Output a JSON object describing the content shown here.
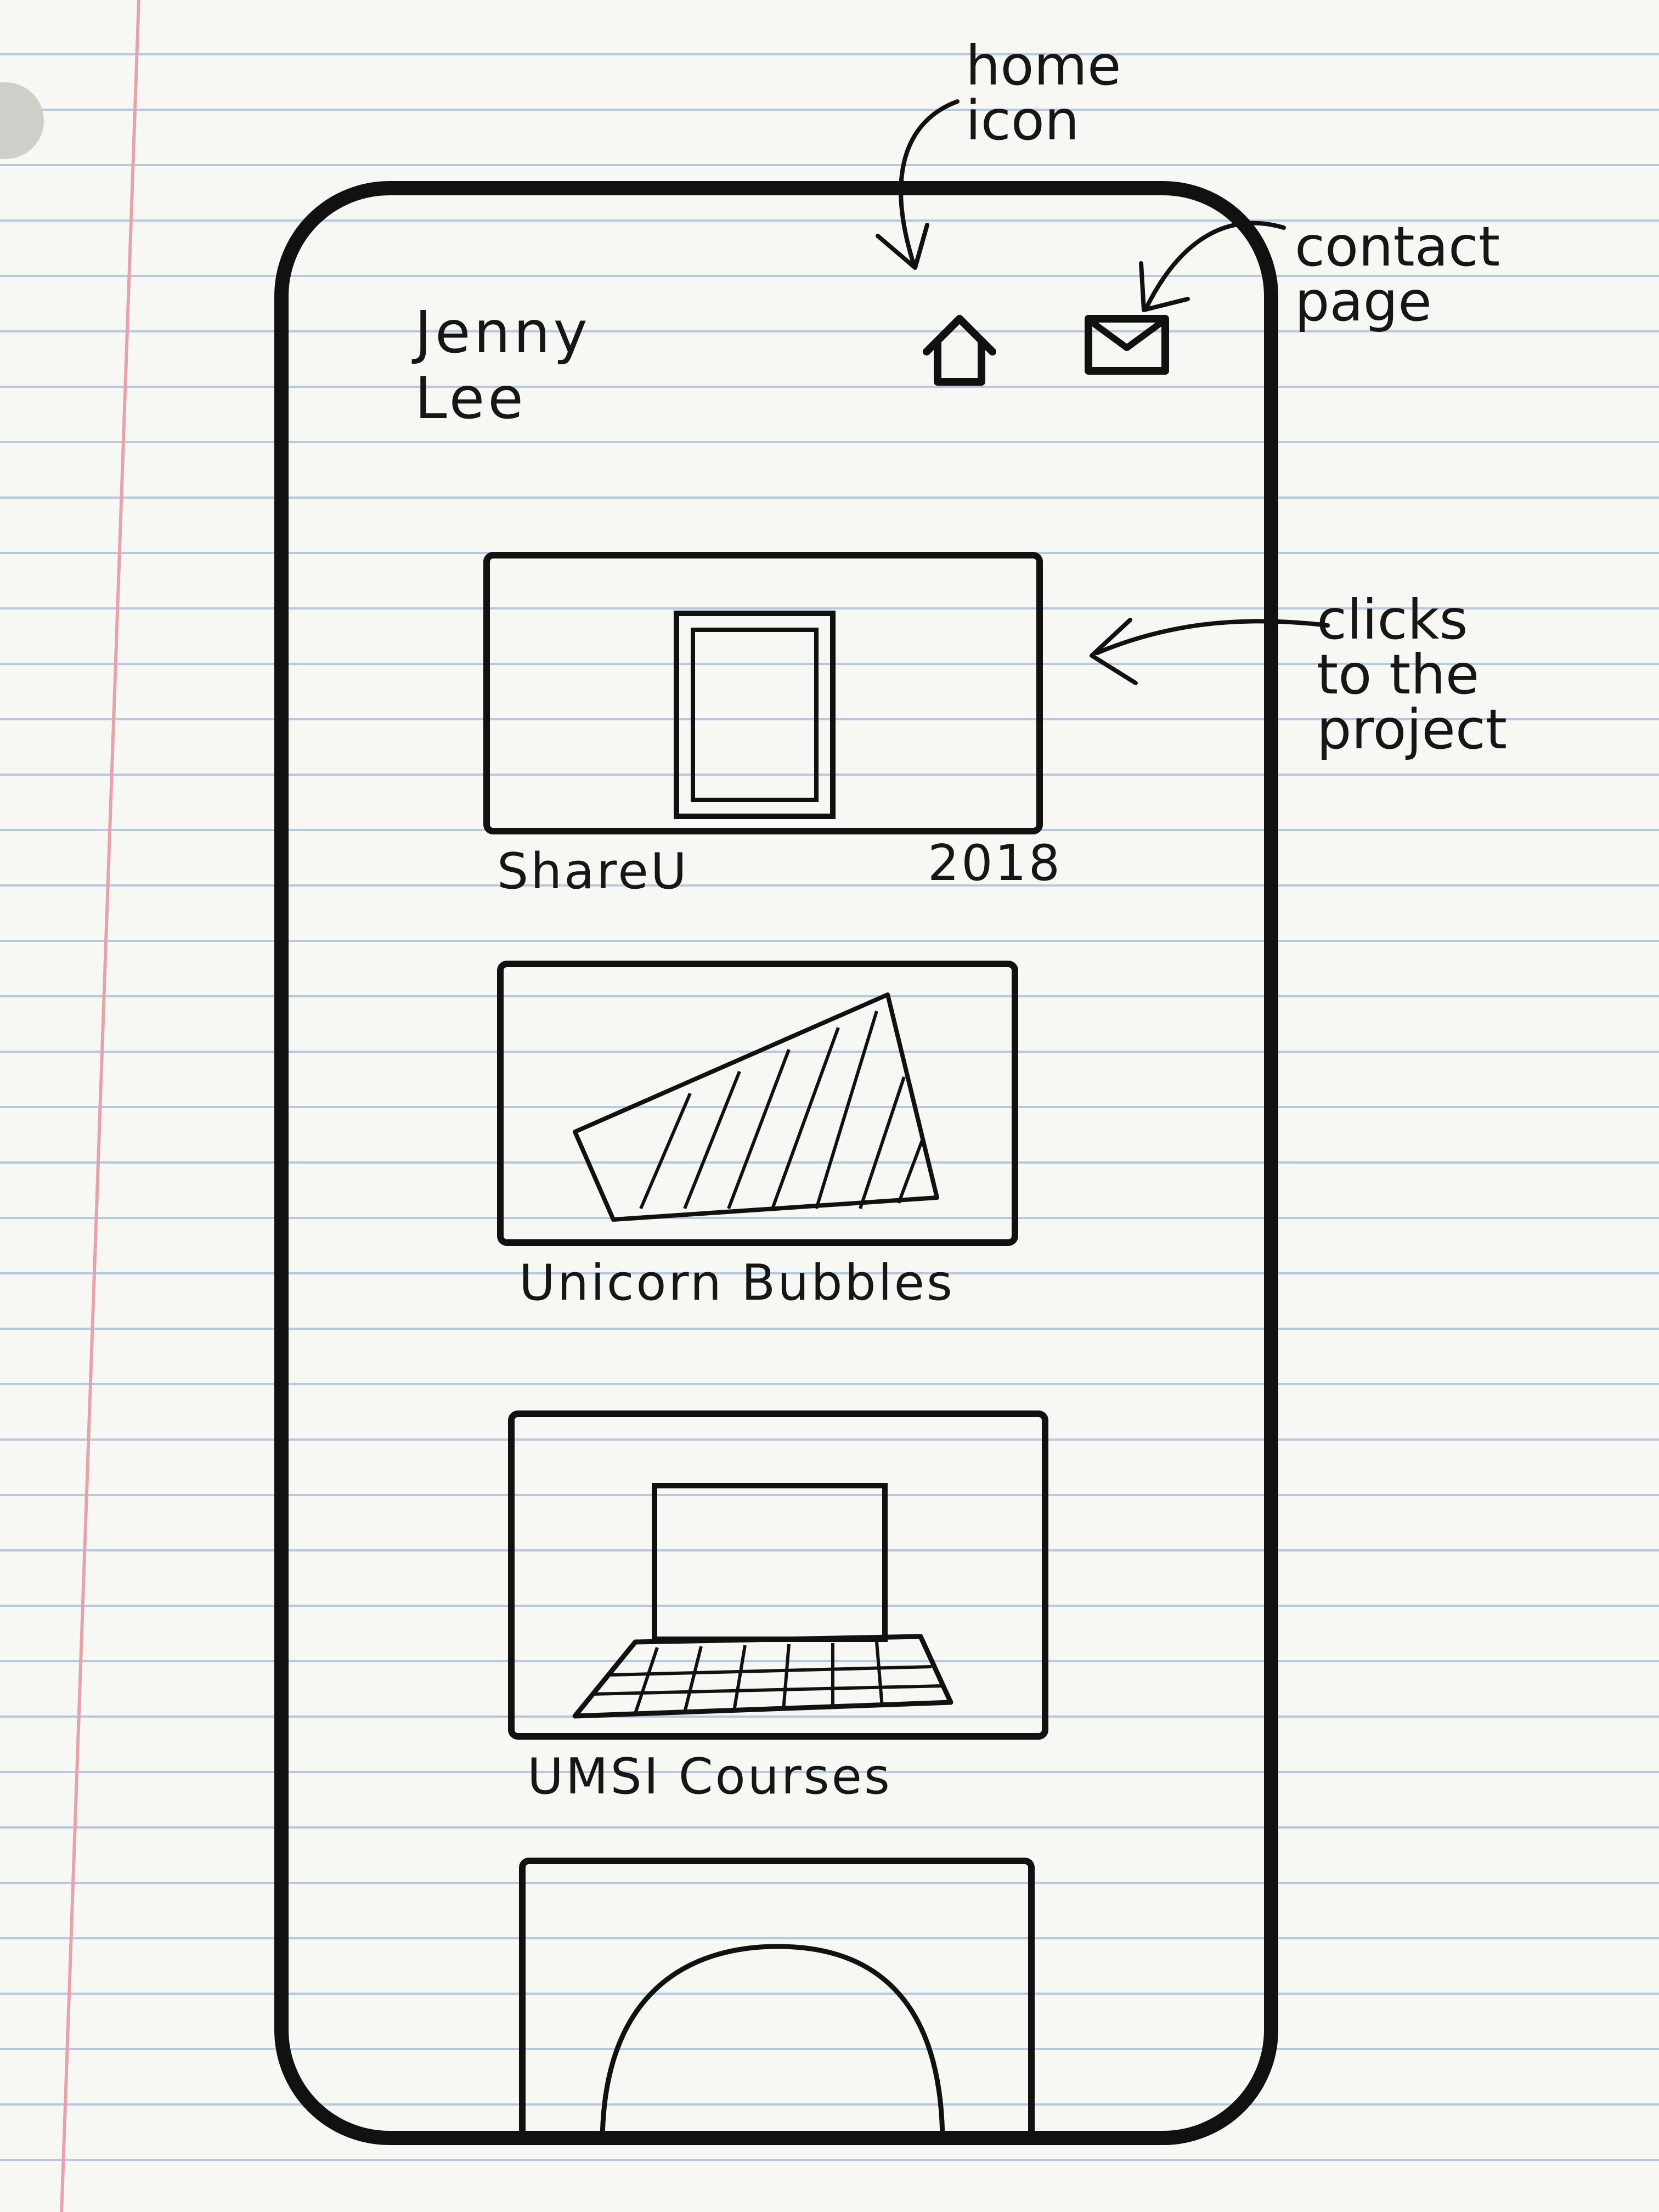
{
  "app": {
    "name_first": "Jenny",
    "name_last": "Lee"
  },
  "nav": {
    "home_icon": "home-icon",
    "contact_icon": "mail-icon"
  },
  "projects": [
    {
      "title": "ShareU",
      "year": "2018",
      "thumbnail": "tablet-sketch"
    },
    {
      "title": "Unicorn Bubbles",
      "year": "",
      "thumbnail": "striped-shape-sketch"
    },
    {
      "title": "UMSI Courses",
      "year": "",
      "thumbnail": "laptop-sketch"
    },
    {
      "title": "",
      "year": "",
      "thumbnail": "arch-sketch"
    }
  ],
  "annotations": {
    "home": "home\nicon",
    "contact": "contact\npage",
    "clicks": "clicks\nto the\nproject"
  },
  "colors": {
    "ink": "#161616",
    "paper": "#f7f7f4",
    "rule_line": "#b7c9e2",
    "margin_line": "#e7a3aa"
  }
}
